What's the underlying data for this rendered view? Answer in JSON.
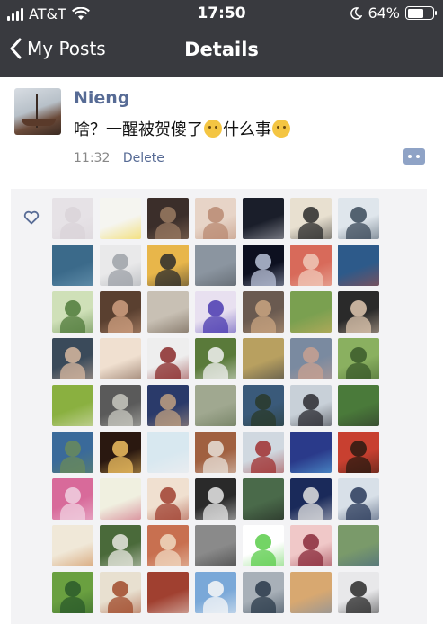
{
  "status_bar": {
    "carrier": "AT&T",
    "time": "17:50",
    "battery_percent": "64%",
    "battery_level": 0.64,
    "icons": [
      "signal-icon",
      "wifi-icon",
      "moon-icon",
      "battery-icon"
    ]
  },
  "nav": {
    "back_label": "My Posts",
    "title": "Details"
  },
  "post": {
    "username": "Nieng",
    "text_part1": "啥？一醒被贺傻了",
    "text_part2": "什么事",
    "time": "11:32",
    "delete_label": "Delete"
  },
  "likes": {
    "icon": "heart-icon",
    "avatars": [
      [
        "#e6e2e6",
        "#d9d3d8"
      ],
      [
        "#f5f5f0",
        "#f2cf1f"
      ],
      [
        "#3b2e2a",
        "#9a7a62"
      ],
      [
        "#e7d4c7",
        "#b98a72"
      ],
      [
        "#1a1e2a",
        "#c4c4cc"
      ],
      [
        "#e8e0d0",
        "#2a2a2a"
      ],
      [
        "#dfe6ec",
        "#3b4a5a"
      ],
      [
        "#3b6a8a",
        "#7aa6c0"
      ],
      [
        "#e9e9ea",
        "#9ea2a8"
      ],
      [
        "#e8b64a",
        "#2c2c2c"
      ],
      [
        "#8b95a0",
        "#4a4f55"
      ],
      [
        "#0d1020",
        "#b9c2d8"
      ],
      [
        "#d86a5a",
        "#f0c8b8"
      ],
      [
        "#2d5a8a",
        "#b64a3a"
      ],
      [
        "#cfe0b8",
        "#4f7a3a"
      ],
      [
        "#5a4030",
        "#d0a080"
      ],
      [
        "#c8c0b4",
        "#5a4a3a"
      ],
      [
        "#e8e0f0",
        "#4a3ab0"
      ],
      [
        "#6a5a50",
        "#c9a480"
      ],
      [
        "#7aa050",
        "#d8b060"
      ],
      [
        "#2a2a2a",
        "#e0c8b0"
      ],
      [
        "#3a4a5a",
        "#d8b8a0"
      ],
      [
        "#f0e0d0",
        "#6a4a3a"
      ],
      [
        "#eeeeee",
        "#8a2a2a"
      ],
      [
        "#5a7a3a",
        "#f2f2f2"
      ],
      [
        "#b8a060",
        "#2a3040"
      ],
      [
        "#7a8aa0",
        "#c8a090"
      ],
      [
        "#8ab060",
        "#3a5a2a"
      ],
      [
        "#8ab040",
        "#e8e8d0"
      ],
      [
        "#5a5a5a",
        "#c8c8c0"
      ],
      [
        "#2a3a6a",
        "#c0a080"
      ],
      [
        "#a0a890",
        "#5a6a4a"
      ],
      [
        "#3a5a7a",
        "#2a3a2a"
      ],
      [
        "#c8d0d8",
        "#2a2a30"
      ],
      [
        "#4a7a3a",
        "#2a2a2a"
      ],
      [
        "#3a6a9a",
        "#6a8a5a"
      ],
      [
        "#2a1810",
        "#f0c060"
      ],
      [
        "#d8e8f0",
        "#f8f0f0"
      ],
      [
        "#a06040",
        "#e8e0d8"
      ],
      [
        "#d0d8e0",
        "#a03030"
      ],
      [
        "#2a3a8a",
        "#60c0f0"
      ],
      [
        "#c84030",
        "#2a1a10"
      ],
      [
        "#d86a9a",
        "#f0d0e0"
      ],
      [
        "#f0f0e0",
        "#c84a6a"
      ],
      [
        "#f0e0d0",
        "#a04030"
      ],
      [
        "#2a2a2a",
        "#e8e8e8"
      ],
      [
        "#4a6a4a",
        "#1a1a1a"
      ],
      [
        "#1a2a5a",
        "#e0e0e0"
      ],
      [
        "#d8e0e8",
        "#2a3a5a"
      ],
      [
        "#f0e8d8",
        "#c87a3a"
      ],
      [
        "#4a6a3a",
        "#e8e8e0"
      ],
      [
        "#c87050",
        "#f0d8c0"
      ],
      [
        "#8a8a8a",
        "#2a2a2a"
      ],
      [
        "#ffffff",
        "#5acc4a"
      ],
      [
        "#f0c8c8",
        "#8a2a3a"
      ],
      [
        "#7a9a6a",
        "#3a5a8a"
      ],
      [
        "#6aa040",
        "#2a5a2a"
      ],
      [
        "#e8e0d0",
        "#a04a2a"
      ],
      [
        "#a04030",
        "#f0e8e0"
      ],
      [
        "#7aa8d8",
        "#f8f8f8"
      ],
      [
        "#a8b0b8",
        "#2a3a4a"
      ],
      [
        "#d8a870",
        "#6a8ab0"
      ],
      [
        "#e8e8ea",
        "#2a2a2a"
      ]
    ]
  }
}
